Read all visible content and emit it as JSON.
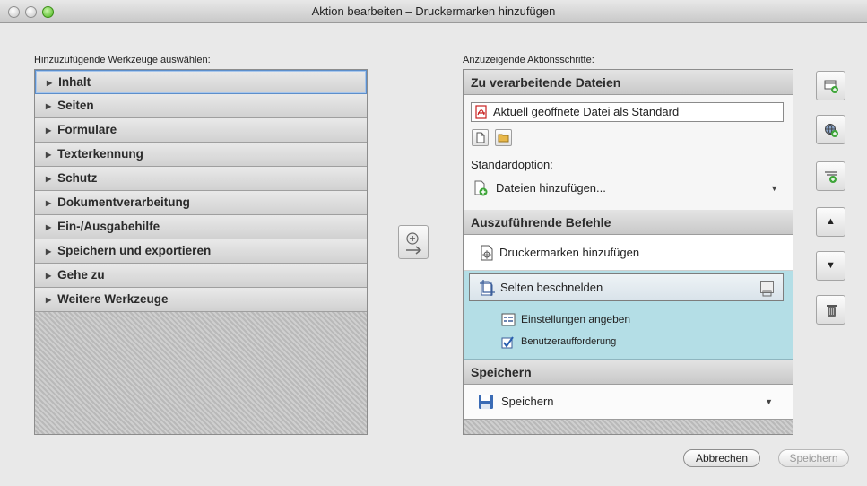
{
  "window": {
    "title": "Aktion bearbeiten – Druckermarken hinzufügen"
  },
  "left": {
    "label": "Hinzuzufügende Werkzeuge auswählen:",
    "items": [
      {
        "label": "Inhalt"
      },
      {
        "label": "Seiten"
      },
      {
        "label": "Formulare"
      },
      {
        "label": "Texterkennung"
      },
      {
        "label": "Schutz"
      },
      {
        "label": "Dokumentverarbeitung"
      },
      {
        "label": "Ein-/Ausgabehilfe"
      },
      {
        "label": "Speichern und exportieren"
      },
      {
        "label": "Gehe zu"
      },
      {
        "label": "Weitere Werkzeuge"
      }
    ]
  },
  "right": {
    "label": "Anzuzeigende Aktionsschritte:",
    "files_section": {
      "header": "Zu verarbeitende Dateien",
      "file_entry": "Aktuell geöffnete Datei als Standard",
      "std_option_label": "Standardoption:",
      "std_option_value": "Dateien hinzufügen..."
    },
    "commands_section": {
      "header": "Auszuführende Befehle",
      "command1": "Druckermarken hinzufügen",
      "command2": "Selten beschnelden",
      "option1": "Einstellungen angeben",
      "option2": "Benutzeraufforderung"
    },
    "save_section": {
      "header": "Speichern",
      "value": "Speichern"
    }
  },
  "buttons": {
    "cancel": "Abbrechen",
    "save": "Speichern"
  },
  "colors": {
    "selection": "#b4dee6",
    "accent_green": "#3fa63a",
    "pdf_red": "#c8201f"
  }
}
